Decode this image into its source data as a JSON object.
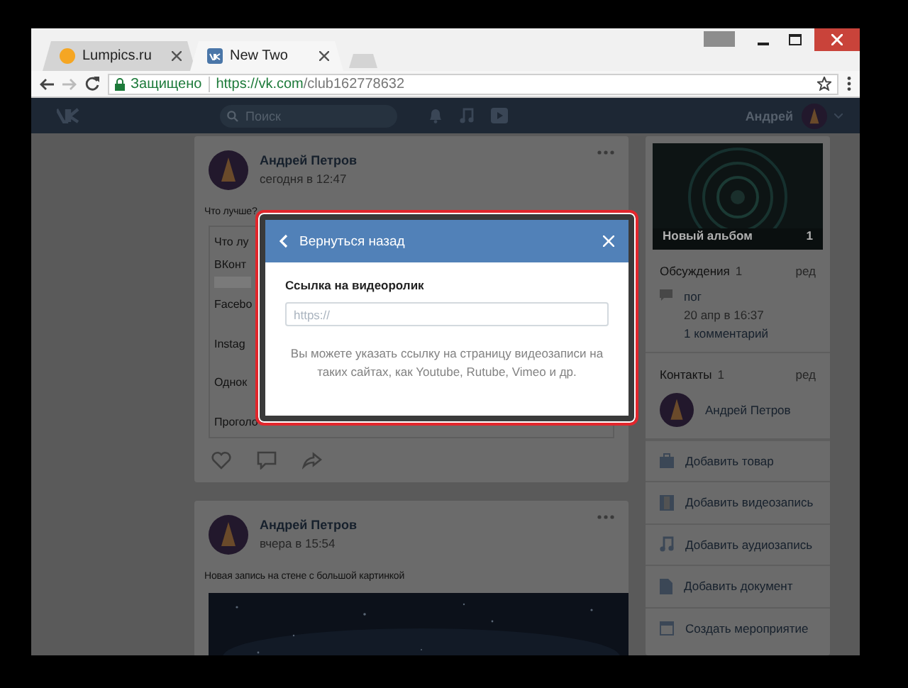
{
  "browser": {
    "tabs": [
      {
        "title": "Lumpics.ru",
        "kind": "site",
        "selected": false
      },
      {
        "title": "New Two",
        "kind": "vk",
        "selected": true
      }
    ],
    "security_label": "Защищено",
    "url_host": "https://vk.com",
    "url_path": "/club162778632"
  },
  "header": {
    "search_placeholder": "Поиск",
    "user_name": "Андрей"
  },
  "posts": [
    {
      "author": "Андрей Петров",
      "time": "сегодня в 12:47",
      "text": "Что лучше?",
      "poll": {
        "title": "Что лу",
        "options": [
          {
            "label": "ВКонт",
            "level": 1
          },
          {
            "label": "Facebo"
          },
          {
            "label": "Instag"
          },
          {
            "label": "Однок"
          }
        ],
        "footer": "Проголо"
      }
    },
    {
      "author": "Андрей Петров",
      "time": "вчера в 15:54",
      "text": "Новая запись на стене с большой картинкой"
    }
  ],
  "sidebar": {
    "album": {
      "title": "Новый альбом",
      "count": "1"
    },
    "discussions": {
      "title": "Обсуждения",
      "count": "1",
      "edit": "ред",
      "topic": {
        "title": "пог",
        "date": "20 апр в 16:37",
        "comments": "1 комментарий"
      }
    },
    "contacts": {
      "title": "Контакты",
      "count": "1",
      "edit": "ред",
      "items": [
        {
          "name": "Андрей Петров"
        }
      ]
    },
    "actions": [
      {
        "kind": "product",
        "label": "Добавить товар"
      },
      {
        "kind": "video",
        "label": "Добавить видеозапись"
      },
      {
        "kind": "audio",
        "label": "Добавить аудиозапись"
      },
      {
        "kind": "document",
        "label": "Добавить документ"
      },
      {
        "kind": "event",
        "label": "Создать мероприятие"
      }
    ]
  },
  "modal": {
    "back_label": "Вернуться назад",
    "field_label": "Ссылка на видеоролик",
    "placeholder": "https://",
    "hint": "Вы можете указать ссылку на страницу видеозаписи на таких сайтах, как Youtube, Rutube, Vimeo и др."
  }
}
